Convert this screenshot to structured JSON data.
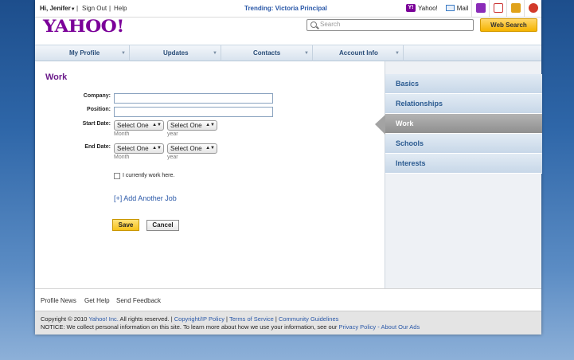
{
  "utility_bar": {
    "greeting": "Hi, Jenifer",
    "sign_out": "Sign Out",
    "help": "Help",
    "trending": "Trending: Victoria Principal",
    "yahoo_link": "Yahoo!",
    "mail_link": "Mail"
  },
  "header": {
    "logo": "YAHOO!",
    "search_placeholder": "Search",
    "search_button": "Web Search"
  },
  "nav": {
    "tabs": [
      "My Profile",
      "Updates",
      "Contacts",
      "Account Info"
    ]
  },
  "form": {
    "section_title": "Work",
    "company_label": "Company:",
    "position_label": "Position:",
    "start_date_label": "Start Date:",
    "end_date_label": "End Date:",
    "select_placeholder": "Select One",
    "month_hint": "Month",
    "year_hint": "year",
    "current_work_label": "I currently work here.",
    "add_another": "[+] Add Another Job",
    "save_label": "Save",
    "cancel_label": "Cancel"
  },
  "sidebar": {
    "items": [
      "Basics",
      "Relationships",
      "Work",
      "Schools",
      "Interests"
    ],
    "active": "Work"
  },
  "footer": {
    "links": [
      "Profile News",
      "Get Help",
      "Send Feedback"
    ],
    "copyright_prefix": "Copyright © 2010 ",
    "company_link": "Yahoo! Inc.",
    "rights": " All rights reserved. | ",
    "copyright_ip": "Copyright/IP Policy",
    "pipe1": " | ",
    "terms": "Terms of Service",
    "pipe2": " | ",
    "guidelines": "Community Guidelines",
    "notice": "NOTICE: We collect personal information on this site. To learn more about how we use your information, see our ",
    "privacy": "Privacy Policy",
    "dash": " - ",
    "about_ads": "About Our Ads"
  },
  "colors": {
    "brand_purple": "#7b0099",
    "link_blue": "#2a58a8",
    "button_yellow": "#f6c21a",
    "sidebar_active": "#a3a3a3"
  }
}
